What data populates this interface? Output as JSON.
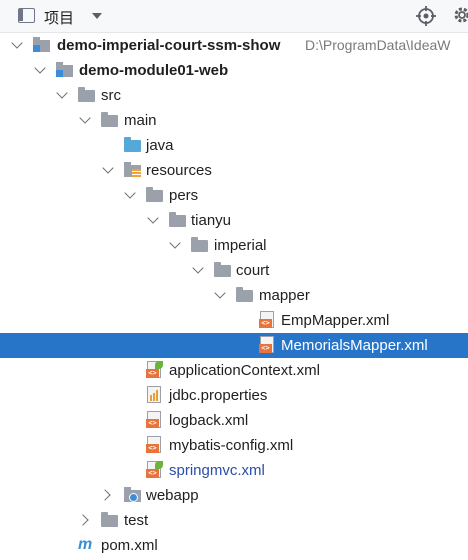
{
  "toolbar": {
    "title": "项目",
    "panel_icon": "project-panel-icon",
    "dropdown_icon": "chevron-down-icon",
    "locate_icon": "locate-target-icon",
    "settings_icon": "gear-icon"
  },
  "tree": {
    "items": [
      {
        "label": "demo-imperial-court-ssm-show",
        "hint": "D:\\ProgramData\\IdeaW",
        "icon": "module-icon",
        "expanded": true,
        "bold": true
      },
      {
        "label": "demo-module01-web",
        "icon": "module-icon",
        "expanded": true,
        "bold": true
      },
      {
        "label": "src",
        "icon": "folder-icon",
        "expanded": true
      },
      {
        "label": "main",
        "icon": "folder-icon",
        "expanded": true
      },
      {
        "label": "java",
        "icon": "source-folder-icon"
      },
      {
        "label": "resources",
        "icon": "resources-folder-icon",
        "expanded": true
      },
      {
        "label": "pers",
        "icon": "folder-icon",
        "expanded": true
      },
      {
        "label": "tianyu",
        "icon": "folder-icon",
        "expanded": true
      },
      {
        "label": "imperial",
        "icon": "folder-icon",
        "expanded": true
      },
      {
        "label": "court",
        "icon": "folder-icon",
        "expanded": true
      },
      {
        "label": "mapper",
        "icon": "folder-icon",
        "expanded": true
      },
      {
        "label": "EmpMapper.xml",
        "icon": "xml-file-icon"
      },
      {
        "label": "MemorialsMapper.xml",
        "icon": "xml-file-icon",
        "selected": true
      },
      {
        "label": "applicationContext.xml",
        "icon": "spring-xml-icon"
      },
      {
        "label": "jdbc.properties",
        "icon": "properties-file-icon"
      },
      {
        "label": "logback.xml",
        "icon": "xml-file-icon"
      },
      {
        "label": "mybatis-config.xml",
        "icon": "xml-file-icon"
      },
      {
        "label": "springmvc.xml",
        "icon": "spring-xml-icon",
        "color": "#2a4dae"
      },
      {
        "label": "webapp",
        "icon": "webapp-folder-icon",
        "expanded": false
      },
      {
        "label": "test",
        "icon": "folder-icon",
        "expanded": false
      },
      {
        "label": "pom.xml",
        "icon": "maven-icon"
      }
    ],
    "xml_badge": "<>",
    "maven_mark": "m"
  },
  "colors": {
    "selection": "#2675c9",
    "link_file": "#2a4dae",
    "hint": "#7a7a7a"
  }
}
